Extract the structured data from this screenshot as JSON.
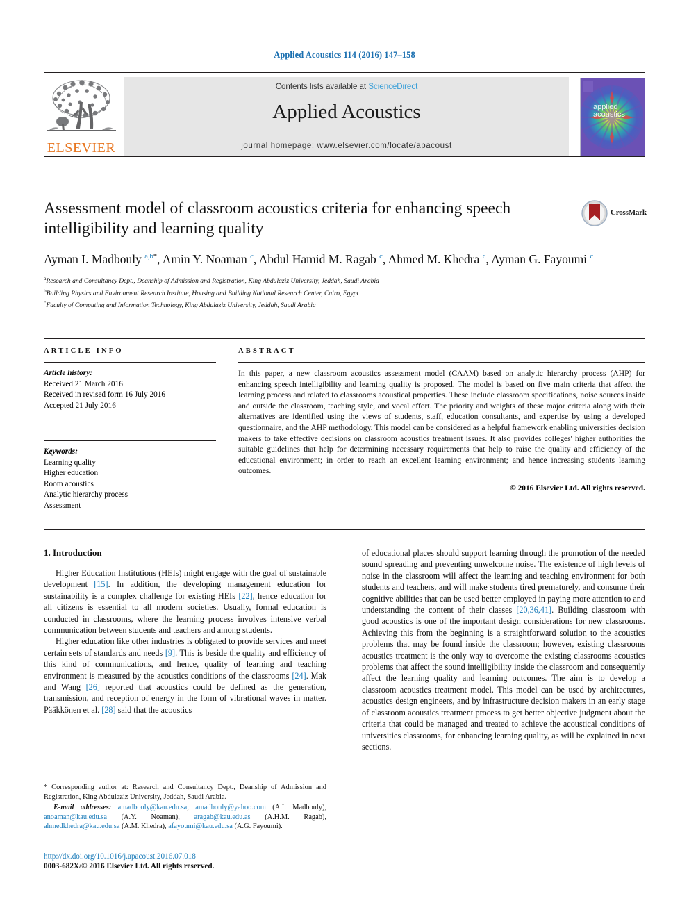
{
  "running_head": "Applied Acoustics 114 (2016) 147–158",
  "masthead": {
    "contents_prefix": "Contents lists available at ",
    "sciencedirect": "ScienceDirect",
    "journal_name": "Applied Acoustics",
    "homepage": "journal homepage: www.elsevier.com/locate/apacoust",
    "publisher": "ELSEVIER",
    "cover_line1": "applied",
    "cover_line2": "acoustics",
    "accent_blue": "#3a9fd8",
    "elsevier_orange": "#e87722"
  },
  "title": "Assessment model of classroom acoustics criteria for enhancing speech intelligibility and learning quality",
  "crossmark": {
    "label": "CrossMark"
  },
  "authors_html": "Ayman I. Madbouly <sup>a,b</sup><sup class=\"star\">*</sup>, Amin Y. Noaman <sup>c</sup>, Abdul Hamid M. Ragab <sup>c</sup>, Ahmed M. Khedra <sup>c</sup>, Ayman G. Fayoumi <sup>c</sup>",
  "affiliations": [
    {
      "marker": "a",
      "text": "Research and Consultancy Dept., Deanship of Admission and Registration, King Abdulaziz University, Jeddah, Saudi Arabia"
    },
    {
      "marker": "b",
      "text": "Building Physics and Environment Research Institute, Housing and Building National Research Center, Cairo, Egypt"
    },
    {
      "marker": "c",
      "text": "Faculty of Computing and Information Technology, King Abdulaziz University, Jeddah, Saudi Arabia"
    }
  ],
  "article_info": {
    "heading": "ARTICLE INFO",
    "history_label": "Article history:",
    "history": [
      "Received 21 March 2016",
      "Received in revised form 16 July 2016",
      "Accepted 21 July 2016"
    ],
    "keywords_label": "Keywords:",
    "keywords": [
      "Learning quality",
      "Higher education",
      "Room acoustics",
      "Analytic hierarchy process",
      "Assessment"
    ]
  },
  "abstract": {
    "heading": "ABSTRACT",
    "text": "In this paper, a new classroom acoustics assessment model (CAAM) based on analytic hierarchy process (AHP) for enhancing speech intelligibility and learning quality is proposed. The model is based on five main criteria that affect the learning process and related to classrooms acoustical properties. These include classroom specifications, noise sources inside and outside the classroom, teaching style, and vocal effort. The priority and weights of these major criteria along with their alternatives are identified using the views of students, staff, education consultants, and expertise by using a developed questionnaire, and the AHP methodology. This model can be considered as a helpful framework enabling universities decision makers to take effective decisions on classroom acoustics treatment issues. It also provides colleges' higher authorities the suitable guidelines that help for determining necessary requirements that help to raise the quality and efficiency of the educational environment; in order to reach an excellent learning environment; and hence increasing students learning outcomes.",
    "copyright": "© 2016 Elsevier Ltd. All rights reserved."
  },
  "body": {
    "section_number_title": "1. Introduction",
    "left_para_1_html": "Higher Education Institutions (HEIs) might engage with the goal of sustainable development <span class=\"ref\">[15]</span>. In addition, the developing management education for sustainability is a complex challenge for existing HEIs <span class=\"ref\">[22]</span>, hence education for all citizens is essential to all modern societies. Usually, formal education is conducted in classrooms, where the learning process involves intensive verbal communication between students and teachers and among students.",
    "left_para_2_html": "Higher education like other industries is obligated to provide services and meet certain sets of standards and needs <span class=\"ref\">[9]</span>. This is beside the quality and efficiency of this kind of communications, and hence, quality of learning and teaching environment is measured by the acoustics conditions of the classrooms <span class=\"ref\">[24]</span>. Mak and Wang <span class=\"ref\">[26]</span> reported that acoustics could be defined as the generation, transmission, and reception of energy in the form of vibrational waves in matter. Pääkkönen et al. <span class=\"ref\">[28]</span> said that the acoustics",
    "right_para_1_html": "of educational places should support learning through the promotion of the needed sound spreading and preventing unwelcome noise. The existence of high levels of noise in the classroom will affect the learning and teaching environment for both students and teachers, and will make students tired prematurely, and consume their cognitive abilities that can be used better employed in paying more attention to and understanding the content of their classes <span class=\"ref\">[20,36,41]</span>. Building classroom with good acoustics is one of the important design considerations for new classrooms. Achieving this from the beginning is a straightforward solution to the acoustics problems that may be found inside the classroom; however, existing classrooms acoustics treatment is the only way to overcome the existing classrooms acoustics problems that affect the sound intelligibility inside the classroom and consequently affect the learning quality and learning outcomes. The aim is to develop a classroom acoustics treatment model. This model can be used by architectures, acoustics design engineers, and by infrastructure decision makers in an early stage of classroom acoustics treatment process to get better objective judgment about the criteria that could be managed and treated to achieve the acoustical conditions of universities classrooms, for enhancing learning quality, as will be explained in next sections."
  },
  "footnote": {
    "corresponding_html": "* Corresponding author at: Research and Consultancy Dept., Deanship of Admission and Registration, King Abdulaziz University, Jeddah, Saudi Arabia.",
    "emails_html": "<span class=\"em-label\">E-mail addresses:</span> <span class=\"mail\">amadbouly@kau.edu.sa</span>, <span class=\"mail\">amadbouly@yahoo.com</span> (A.I. Madbouly), <span class=\"mail\">anoaman@kau.edu.sa</span> (A.Y. Noaman), <span class=\"mail\">aragab@kau.edu.as</span> (A.H.M. Ragab), <span class=\"mail\">ahmedkhedra@kau.edu.sa</span> (A.M. Khedra), <span class=\"mail\">afayoumi@kau.edu.sa</span> (A.G. Fayoumi)."
  },
  "doi": {
    "url": "http://dx.doi.org/10.1016/j.apacoust.2016.07.018",
    "issn_line": "0003-682X/© 2016 Elsevier Ltd. All rights reserved."
  }
}
